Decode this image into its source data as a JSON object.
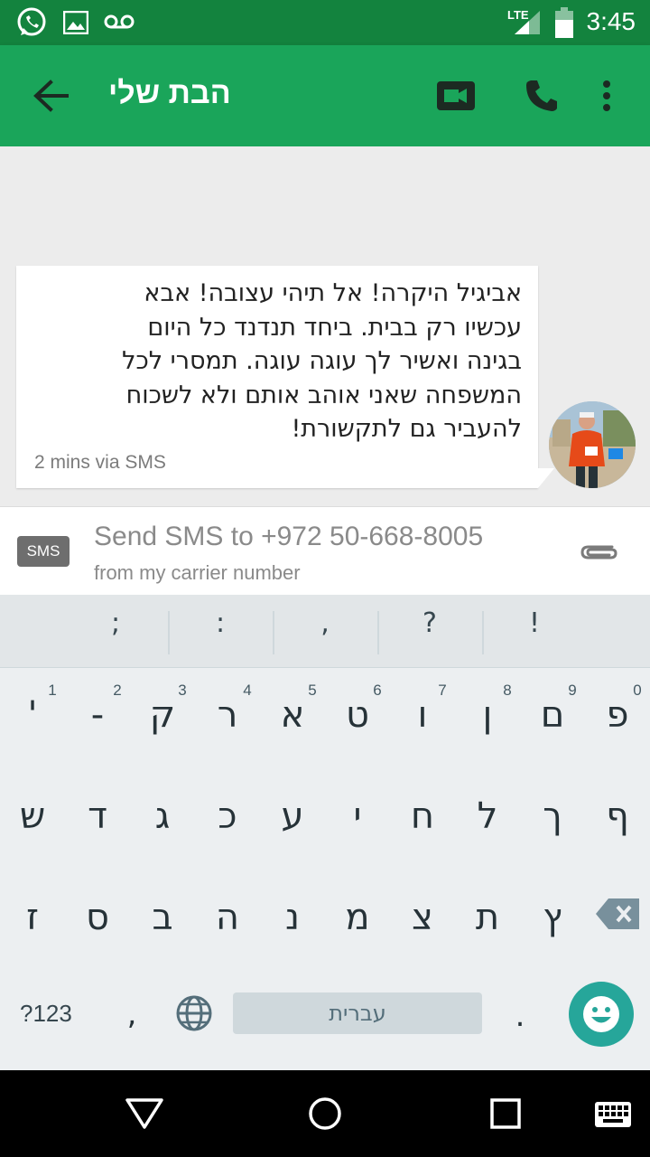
{
  "status_bar": {
    "time": "3:45",
    "network": "LTE"
  },
  "app_bar": {
    "title": "הבת שלי",
    "icons": [
      "back-arrow-icon",
      "video-call-icon",
      "phone-icon",
      "more-vert-icon"
    ]
  },
  "message": {
    "lines": [
      "אביגיל היקרה! אל תיהי עצובה! אבא",
      "עכשיו רק בבית. ביחד תנדנד כל היום",
      "בגינה ואשיר לך עוגה עוגה. תמסרי לכל",
      "המשפחה שאני אוהב אותם ולא לשכוח",
      "להעביר גם לתקשורת!"
    ],
    "meta": "2 mins via SMS"
  },
  "compose": {
    "badge": "SMS",
    "placeholder": "Send SMS to +972 50-668-8005",
    "subtitle": "from my carrier number"
  },
  "keyboard": {
    "suggestions": [
      ";",
      ":",
      ",",
      "?",
      "!"
    ],
    "row1": [
      {
        "k": "פ",
        "n": "0"
      },
      {
        "k": "ם",
        "n": "9"
      },
      {
        "k": "ן",
        "n": "8"
      },
      {
        "k": "ו",
        "n": "7"
      },
      {
        "k": "ט",
        "n": "6"
      },
      {
        "k": "א",
        "n": "5"
      },
      {
        "k": "ר",
        "n": "4"
      },
      {
        "k": "ק",
        "n": "3"
      },
      {
        "k": "-",
        "n": "2"
      },
      {
        "k": "'",
        "n": "1"
      }
    ],
    "row2": [
      "ף",
      "ך",
      "ל",
      "ח",
      "י",
      "ע",
      "כ",
      "ג",
      "ד",
      "ש"
    ],
    "row3": [
      "ץ",
      "ת",
      "צ",
      "מ",
      "נ",
      "ה",
      "ב",
      "ס",
      "ז"
    ],
    "symbols": "?123",
    "comma": ",",
    "space": "עברית",
    "period": "."
  }
}
